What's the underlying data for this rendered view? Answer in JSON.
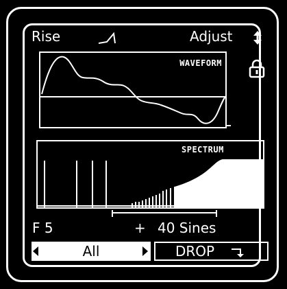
{
  "header": {
    "mode_label": "Rise",
    "adjust_label": "Adjust"
  },
  "waveform": {
    "title": "WAVEFORM"
  },
  "spectrum": {
    "title": "SPECTRUM"
  },
  "status": {
    "note": "F 5",
    "plus": "+",
    "sines": "40 Sines"
  },
  "selector": {
    "value": "All"
  },
  "drop_button": {
    "label": "DROP"
  },
  "icons": {
    "rise": "rise-envelope-icon",
    "adjust": "up-down-arrows-icon",
    "lock": "padlock-icon",
    "drop": "return-arrow-icon"
  },
  "colors": {
    "background": "#000000",
    "foreground": "#ffffff"
  }
}
